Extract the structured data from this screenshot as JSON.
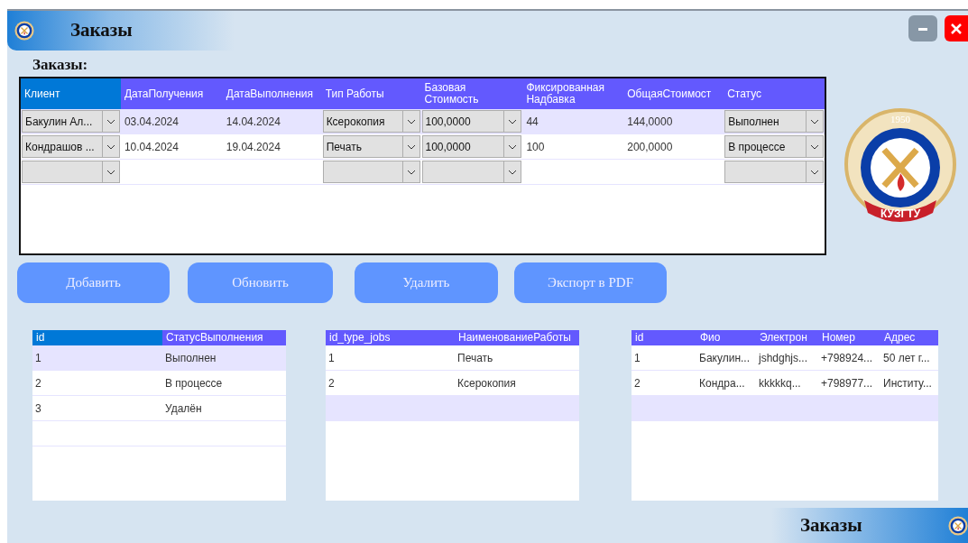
{
  "window": {
    "title": "Заказы",
    "footer_title": "Заказы"
  },
  "orders": {
    "label": "Заказы:",
    "columns": [
      {
        "label": "Клиент",
        "kind": "combo",
        "highlighted": true
      },
      {
        "label": "ДатаПолучения",
        "kind": "text",
        "highlighted": false
      },
      {
        "label": "ДатаВыполнения",
        "kind": "text",
        "highlighted": false
      },
      {
        "label": "Тип Работы",
        "kind": "combo",
        "highlighted": false
      },
      {
        "label": "Базовая Стоимость",
        "kind": "combo",
        "highlighted": false
      },
      {
        "label": "Фиксированная Надбавка",
        "kind": "text",
        "highlighted": false
      },
      {
        "label": "ОбщаяСтоимост",
        "kind": "text",
        "highlighted": false
      },
      {
        "label": "Статус",
        "kind": "combo",
        "highlighted": false
      }
    ],
    "rows": [
      {
        "selected": true,
        "cells": [
          "Бакулин Ал...",
          "03.04.2024",
          "14.04.2024",
          "Ксерокопия",
          "100,0000",
          "44",
          "144,0000",
          "Выполнен"
        ]
      },
      {
        "selected": false,
        "cells": [
          "Кондрашов ...",
          "10.04.2024",
          "19.04.2024",
          "Печать",
          "100,0000",
          "100",
          "200,0000",
          "В процессе"
        ]
      }
    ],
    "new_row": {
      "selected": false
    }
  },
  "logo": {
    "year": "1950",
    "name": "КУЗГТУ"
  },
  "buttons": [
    "Добавить",
    "Обновить",
    "Удалить",
    "Экспорт в PDF"
  ],
  "tables": [
    {
      "columns": [
        {
          "label": "id",
          "highlighted": true
        },
        {
          "label": "СтатусВыполнения",
          "highlighted": false
        }
      ],
      "rows": [
        {
          "selected": true,
          "cells": [
            "1",
            "Выполнен"
          ]
        },
        {
          "selected": false,
          "cells": [
            "2",
            "В процессе"
          ]
        },
        {
          "selected": false,
          "cells": [
            "3",
            "Удалён"
          ]
        }
      ],
      "new_row": {
        "selected": false
      }
    },
    {
      "columns": [
        {
          "label": "id_type_jobs",
          "highlighted": false
        },
        {
          "label": "НаименованиеРаботы",
          "highlighted": false
        }
      ],
      "rows": [
        {
          "selected": false,
          "cells": [
            "1",
            "Печать"
          ]
        },
        {
          "selected": false,
          "cells": [
            "2",
            "Ксерокопия"
          ]
        }
      ],
      "new_row": {
        "selected": true
      }
    },
    {
      "columns": [
        {
          "label": "id",
          "highlighted": false
        },
        {
          "label": "Фио",
          "highlighted": false
        },
        {
          "label": "Электрон",
          "highlighted": false
        },
        {
          "label": "Номер",
          "highlighted": false
        },
        {
          "label": "Адрес",
          "highlighted": false
        }
      ],
      "rows": [
        {
          "selected": false,
          "cells": [
            "1",
            "Бакулин...",
            "jshdghjs...",
            "+798924...",
            "50 лет г..."
          ]
        },
        {
          "selected": false,
          "cells": [
            "2",
            "Кондра...",
            "kkkkkq...",
            "+798977...",
            "Институ..."
          ]
        }
      ],
      "new_row": {
        "selected": true
      }
    }
  ]
}
